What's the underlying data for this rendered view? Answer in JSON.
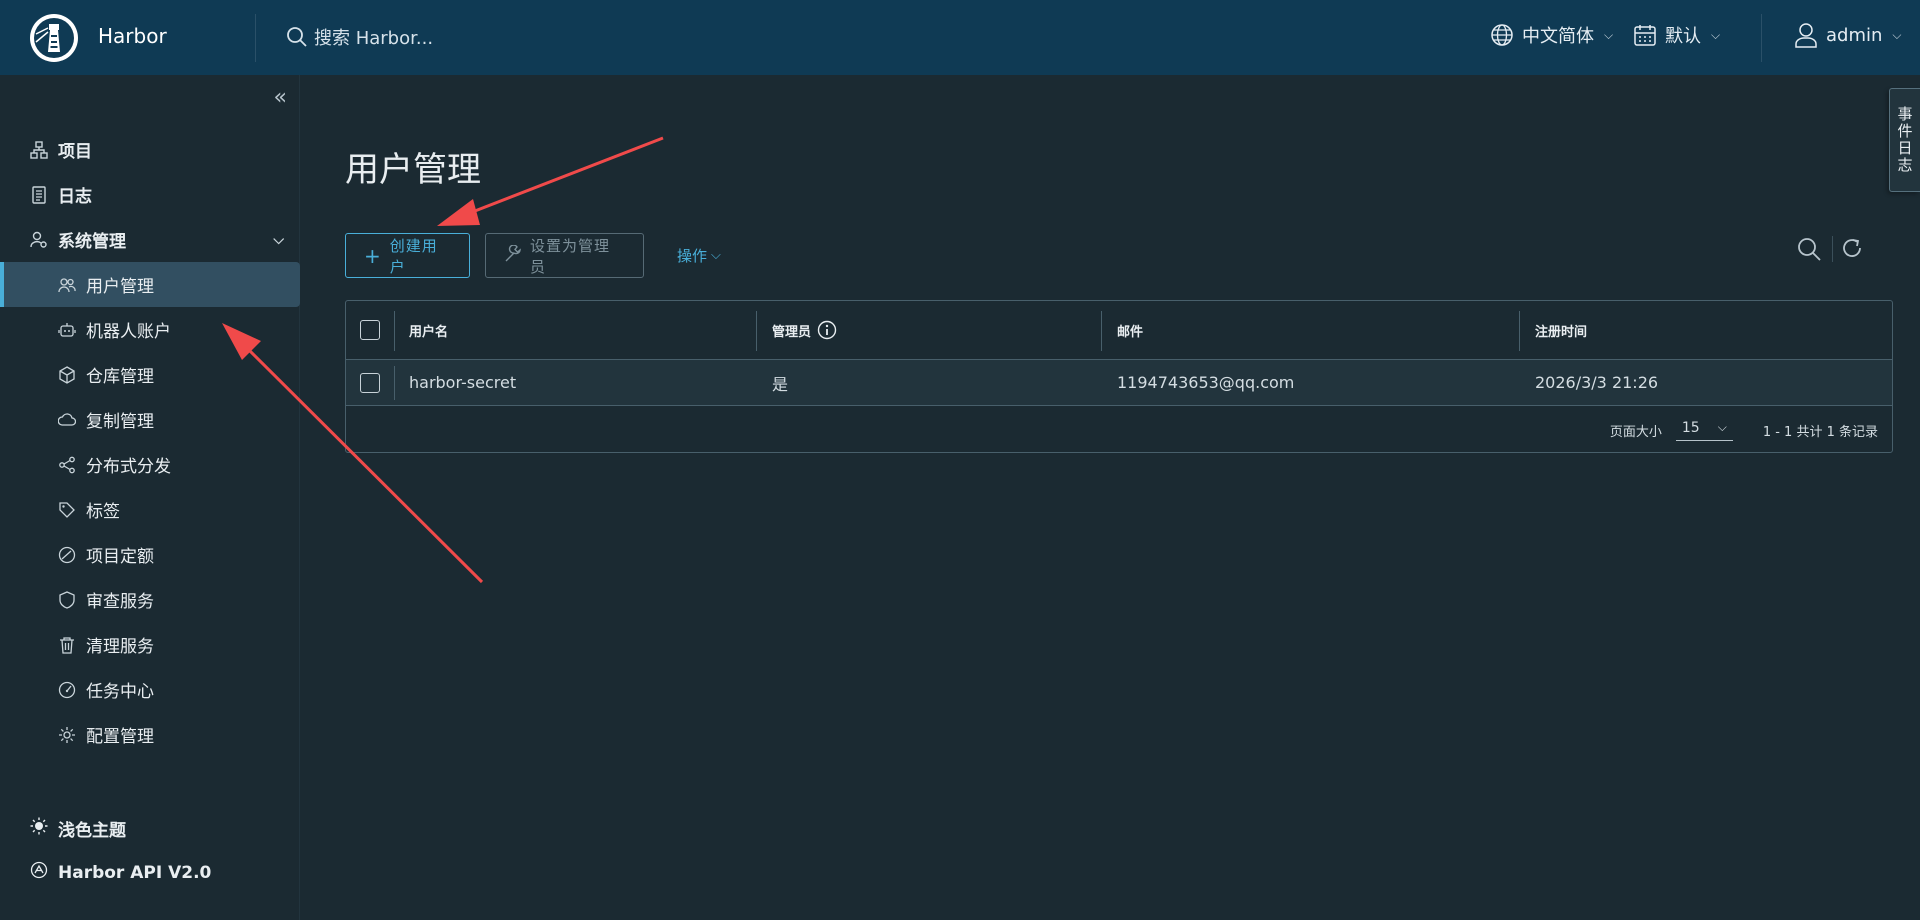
{
  "app": {
    "brand": "Harbor"
  },
  "header": {
    "search_placeholder": "搜索 Harbor...",
    "language": "中文简体",
    "datetime": "默认",
    "user": "admin"
  },
  "sidebar": {
    "items": [
      {
        "label": "项目",
        "icon": "projects-icon"
      },
      {
        "label": "日志",
        "icon": "logs-icon"
      },
      {
        "label": "系统管理",
        "icon": "system-admin-icon"
      }
    ],
    "sub_items": [
      {
        "label": "用户管理",
        "icon": "users-icon",
        "active": true
      },
      {
        "label": "机器人账户",
        "icon": "robot-icon"
      },
      {
        "label": "仓库管理",
        "icon": "registry-icon"
      },
      {
        "label": "复制管理",
        "icon": "replication-icon"
      },
      {
        "label": "分布式分发",
        "icon": "distribution-icon"
      },
      {
        "label": "标签",
        "icon": "tag-icon"
      },
      {
        "label": "项目定额",
        "icon": "quota-icon"
      },
      {
        "label": "审查服务",
        "icon": "shield-icon"
      },
      {
        "label": "清理服务",
        "icon": "trash-icon"
      },
      {
        "label": "任务中心",
        "icon": "dashboard-icon"
      },
      {
        "label": "配置管理",
        "icon": "gear-icon"
      }
    ],
    "theme_toggle": "浅色主题",
    "api_link": "Harbor API V2.0"
  },
  "main": {
    "title": "用户管理",
    "create_button": "创建用户",
    "set_admin_button": "设置为管理员",
    "actions_button": "操作",
    "table": {
      "headers": [
        "用户名",
        "管理员",
        "邮件",
        "注册时间"
      ],
      "rows": [
        {
          "username": "harbor-secret",
          "admin": "是",
          "email": "1194743653@qq.com",
          "registered": "2026/3/3 21:26"
        }
      ],
      "page_size_label": "页面大小",
      "page_size": "15",
      "summary": "1 - 1 共计 1 条记录"
    }
  },
  "event_log_tab": "事件日志",
  "colors": {
    "header_bg": "#0f3a54",
    "accent": "#49afd9",
    "body_bg": "#1b2a32",
    "arrow": "#f04a4a"
  }
}
